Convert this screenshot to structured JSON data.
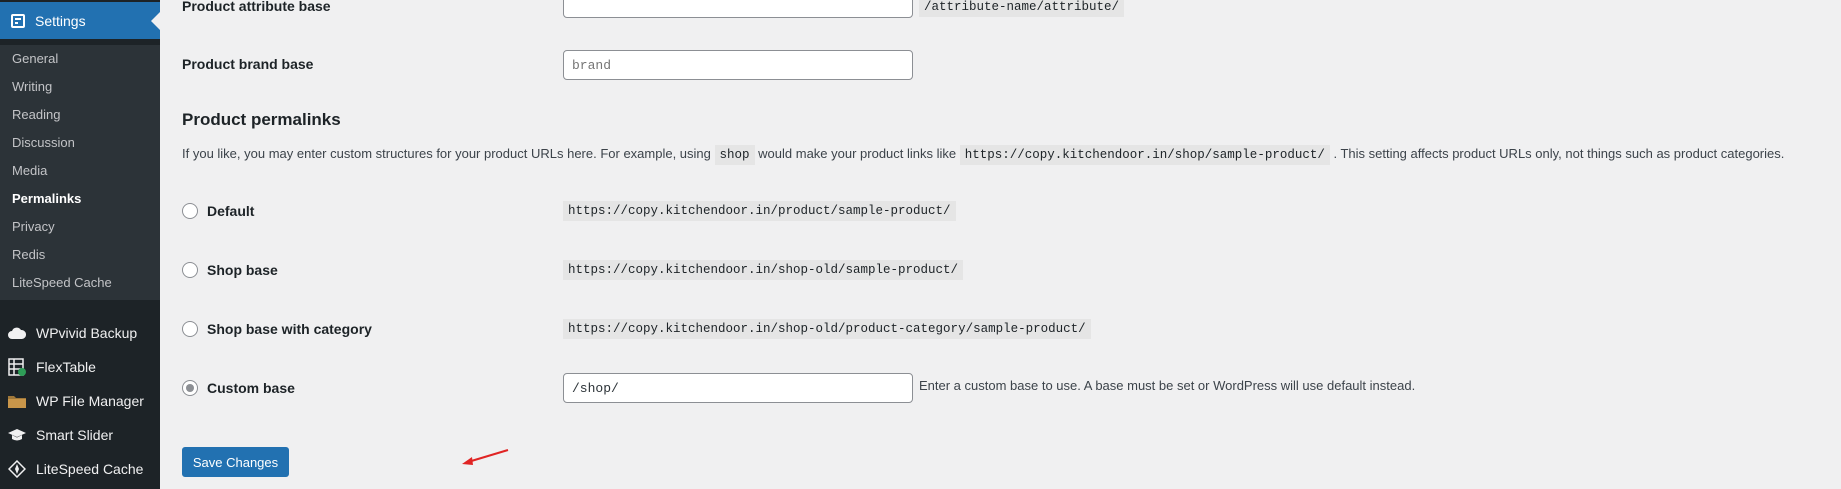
{
  "sidebar": {
    "settings_label": "Settings",
    "submenu": [
      "General",
      "Writing",
      "Reading",
      "Discussion",
      "Media",
      "Permalinks",
      "Privacy",
      "Redis",
      "LiteSpeed Cache"
    ],
    "current": "Permalinks",
    "plugins": [
      {
        "label": "WPvivid Backup",
        "icon": "cloud-icon"
      },
      {
        "label": "FlexTable",
        "icon": "table-icon"
      },
      {
        "label": "WP File Manager",
        "icon": "folder-icon"
      },
      {
        "label": "Smart Slider",
        "icon": "graduation-cap-icon"
      },
      {
        "label": "LiteSpeed Cache",
        "icon": "diamond-icon"
      }
    ]
  },
  "main": {
    "attribute_base": {
      "label": "Product attribute base",
      "value": "",
      "hint": "/attribute-name/attribute/"
    },
    "brand_base": {
      "label": "Product brand base",
      "placeholder": "brand"
    },
    "section_title": "Product permalinks",
    "description": {
      "part1": "If you like, you may enter custom structures for your product URLs here. For example, using",
      "code1": "shop",
      "part2": "would make your product links like",
      "code2": "https://copy.kitchendoor.in/shop/sample-product/",
      "part3": ". This setting affects product URLs only, not things such as product categories."
    },
    "options": [
      {
        "label": "Default",
        "url": "https://copy.kitchendoor.in/product/sample-product/",
        "checked": false
      },
      {
        "label": "Shop base",
        "url": "https://copy.kitchendoor.in/shop-old/sample-product/",
        "checked": false
      },
      {
        "label": "Shop base with category",
        "url": "https://copy.kitchendoor.in/shop-old/product-category/sample-product/",
        "checked": false
      },
      {
        "label": "Custom base",
        "value": "/shop/",
        "checked": true
      }
    ],
    "custom_hint": "Enter a custom base to use. A base must be set or WordPress will use default instead.",
    "save_label": "Save Changes"
  },
  "colors": {
    "accent": "#2271b1",
    "sidebar": "#1d2327",
    "submenu": "#2c3338",
    "arrow": "#e02424"
  }
}
